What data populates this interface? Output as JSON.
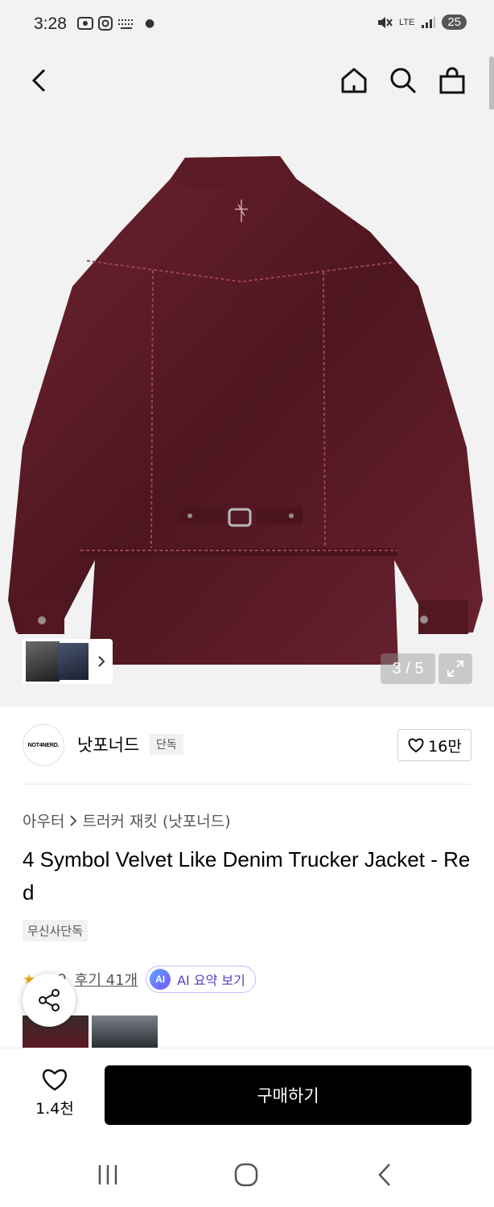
{
  "status_bar": {
    "time": "3:28",
    "battery": "25",
    "network": "LTE"
  },
  "hero": {
    "counter": "3 / 5",
    "product_color": "#5a1a24"
  },
  "brand": {
    "logo_text": "NOT4NERD.",
    "name": "낫포너드",
    "badge": "단독",
    "likes": "16만"
  },
  "breadcrumb": {
    "category": "아우터",
    "sub": "트러커 재킷 (낫포너드)"
  },
  "product": {
    "title": "4 Symbol Velvet Like Denim Trucker Jacket - Red",
    "tag": "무신사단독",
    "rating": "4.9",
    "review_link": "후기 41개",
    "ai_badge": "AI",
    "ai_label": "AI 요약 보기"
  },
  "bottom_bar": {
    "wish_count": "1.4천",
    "buy_label": "구매하기"
  },
  "colors": {
    "accent_purple": "#5b3cc4",
    "buy_button": "#000000",
    "rating_star": "#f5a623"
  }
}
